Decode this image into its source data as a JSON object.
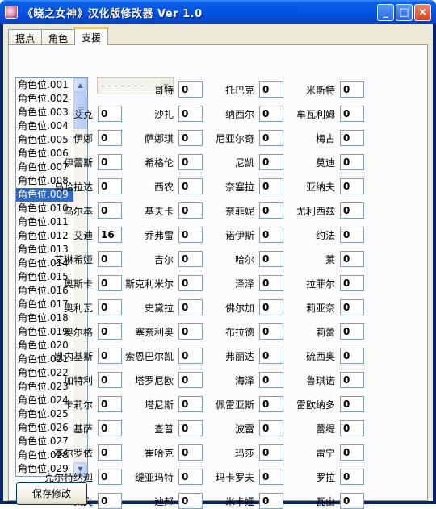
{
  "window": {
    "title": "《晓之女神》汉化版修改器 Ver 1.0",
    "controls": {
      "minimize": "_",
      "maximize": "□",
      "close": "×"
    }
  },
  "tabs": [
    {
      "label": "据点",
      "active": false
    },
    {
      "label": "角色",
      "active": false
    },
    {
      "label": "支援",
      "active": true
    }
  ],
  "character_list": {
    "items": [
      "角色位.001",
      "角色位.002",
      "角色位.003",
      "角色位.004",
      "角色位.005",
      "角色位.006",
      "角色位.007",
      "角色位.008",
      "角色位.009",
      "角色位.010",
      "角色位.011",
      "角色位.012",
      "角色位.013",
      "角色位.014",
      "角色位.015",
      "角色位.016",
      "角色位.017",
      "角色位.018",
      "角色位.019",
      "角色位.020",
      "角色位.021",
      "角色位.022",
      "角色位.023",
      "角色位.024",
      "角色位.025",
      "角色位.026",
      "角色位.027",
      "角色位.028",
      "角色位.029"
    ],
    "selected": "角色位.009"
  },
  "combo": {
    "value": "- - - - - - -"
  },
  "save_button": "保存修改",
  "support_fields": [
    [
      "",
      "哥特",
      "托巴克",
      "米斯特"
    ],
    [
      "艾克",
      "沙扎",
      "纳西尔",
      "牟瓦利姆"
    ],
    [
      "伊娜",
      "萨娜琪",
      "尼亚尔奇",
      "梅古"
    ],
    [
      "伊蕾斯",
      "希格伦",
      "尼凯",
      "莫迪"
    ],
    [
      "乌哈拉达",
      "西农",
      "奈塞拉",
      "亚纳夫"
    ],
    [
      "乌尔基",
      "基夫卡",
      "奈菲妮",
      "尤利西兹"
    ],
    [
      "艾迪",
      "乔弗雷",
      "诺伊斯",
      "约法"
    ],
    [
      "艾琳希娅",
      "吉尔",
      "哈尔",
      "莱"
    ],
    [
      "奥斯卡",
      "斯克利米尔",
      "泽泽",
      "拉菲尔"
    ],
    [
      "奥利瓦",
      "史黛拉",
      "佛尔加",
      "莉亚奈"
    ],
    [
      "奥尔格",
      "塞奈利奥",
      "布拉德",
      "莉蕾"
    ],
    [
      "凯内基斯",
      "索恩巴尔凯",
      "弗丽达",
      "硫西奥"
    ],
    [
      "加特利",
      "塔罗尼欧",
      "海泽",
      "鲁琪诺"
    ],
    [
      "卡莉尔",
      "塔尼斯",
      "佩雷亚斯",
      "雷欧纳多"
    ],
    [
      "基萨",
      "查普",
      "波雷",
      "蕾缇"
    ],
    [
      "基尔罗依",
      "崔哈克",
      "玛莎",
      "雷宁"
    ],
    [
      "克尔特纳迦",
      "缇亚玛特",
      "玛卡罗夫",
      "罗拉"
    ],
    [
      "凯文",
      "迪邦",
      "米卡娅",
      "瓦由"
    ]
  ],
  "support_values": [
    [
      null,
      "0",
      "0",
      "0"
    ],
    [
      "0",
      "0",
      "0",
      "0"
    ],
    [
      "0",
      "0",
      "0",
      "0"
    ],
    [
      "0",
      "0",
      "0",
      "0"
    ],
    [
      "0",
      "0",
      "0",
      "0"
    ],
    [
      "0",
      "0",
      "0",
      "0"
    ],
    [
      "16",
      "0",
      "0",
      "0"
    ],
    [
      "0",
      "0",
      "0",
      "0"
    ],
    [
      "0",
      "0",
      "0",
      "0"
    ],
    [
      "0",
      "0",
      "0",
      "0"
    ],
    [
      "0",
      "0",
      "0",
      "0"
    ],
    [
      "0",
      "0",
      "0",
      "0"
    ],
    [
      "0",
      "0",
      "0",
      "0"
    ],
    [
      "0",
      "0",
      "0",
      "0"
    ],
    [
      "0",
      "0",
      "0",
      "0"
    ],
    [
      "0",
      "0",
      "0",
      "0"
    ],
    [
      "0",
      "0",
      "0",
      "0"
    ],
    [
      "0",
      "0",
      "0",
      "0"
    ]
  ]
}
